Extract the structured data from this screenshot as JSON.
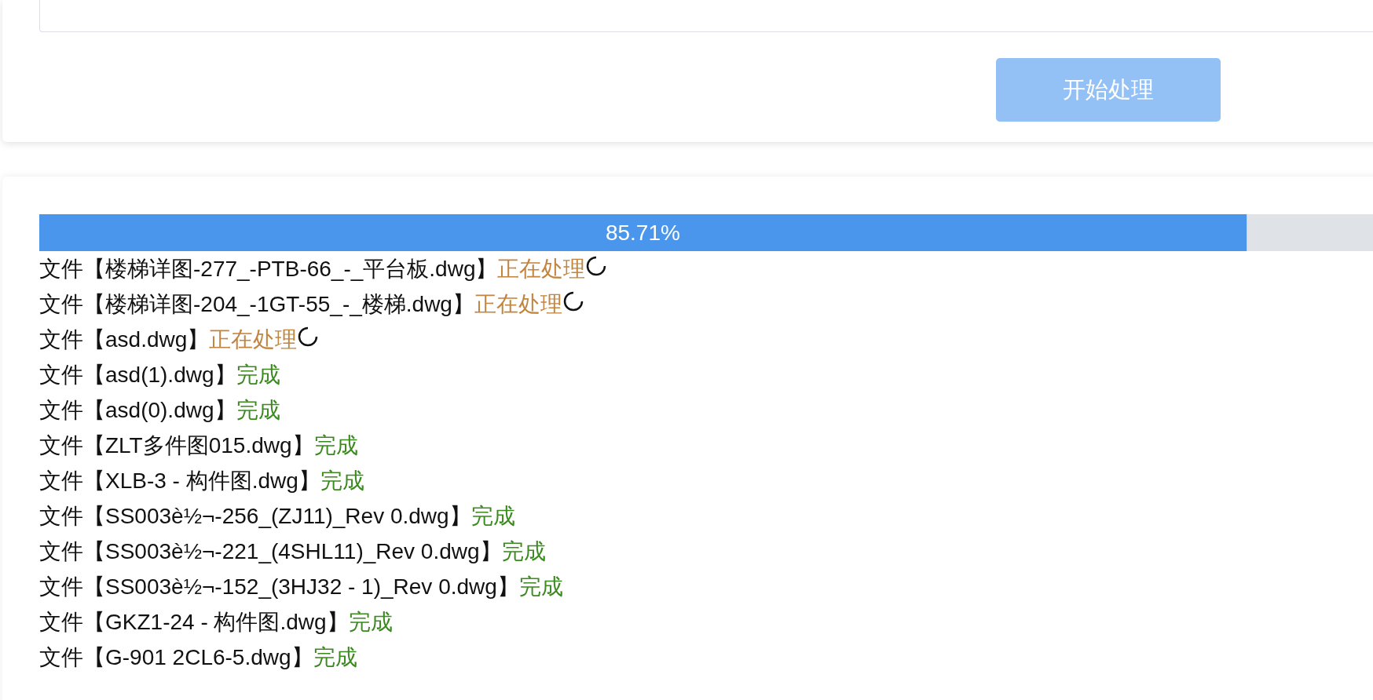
{
  "form": {
    "start_button": {
      "label": "开始处理",
      "disabled": true
    }
  },
  "progress": {
    "level": 0.8571,
    "reading": "85.71%"
  },
  "files": [
    {
      "prefix": "文件",
      "name": "【楼梯详图-277_-PTB-66_-_平台板.dwg】",
      "status": "正在处理",
      "kind": "processing"
    },
    {
      "prefix": "文件",
      "name": "【楼梯详图-204_-1GT-55_-_楼梯.dwg】",
      "status": "正在处理",
      "kind": "processing"
    },
    {
      "prefix": "文件",
      "name": "【asd.dwg】",
      "status": "正在处理",
      "kind": "processing"
    },
    {
      "prefix": "文件",
      "name": "【asd(1).dwg】",
      "status": "完成",
      "kind": "done"
    },
    {
      "prefix": "文件",
      "name": "【asd(0).dwg】",
      "status": "完成",
      "kind": "done"
    },
    {
      "prefix": "文件",
      "name": "【ZLT多件图015.dwg】",
      "status": "完成",
      "kind": "done"
    },
    {
      "prefix": "文件",
      "name": "【XLB-3 - 构件图.dwg】",
      "status": "完成",
      "kind": "done"
    },
    {
      "prefix": "文件",
      "name": "【SS003è½¬-256_(ZJ11)_Rev 0.dwg】",
      "status": "完成",
      "kind": "done"
    },
    {
      "prefix": "文件",
      "name": "【SS003è½¬-221_(4SHL11)_Rev 0.dwg】",
      "status": "完成",
      "kind": "done"
    },
    {
      "prefix": "文件",
      "name": "【SS003è½¬-152_(3HJ32 - 1)_Rev 0.dwg】",
      "status": "完成",
      "kind": "done"
    },
    {
      "prefix": "文件",
      "name": "【GKZ1-24 - 构件图.dwg】",
      "status": "完成",
      "kind": "done"
    },
    {
      "prefix": "文件",
      "name": "【G-901 2CL6-5.dwg】",
      "status": "完成",
      "kind": "done"
    }
  ]
}
